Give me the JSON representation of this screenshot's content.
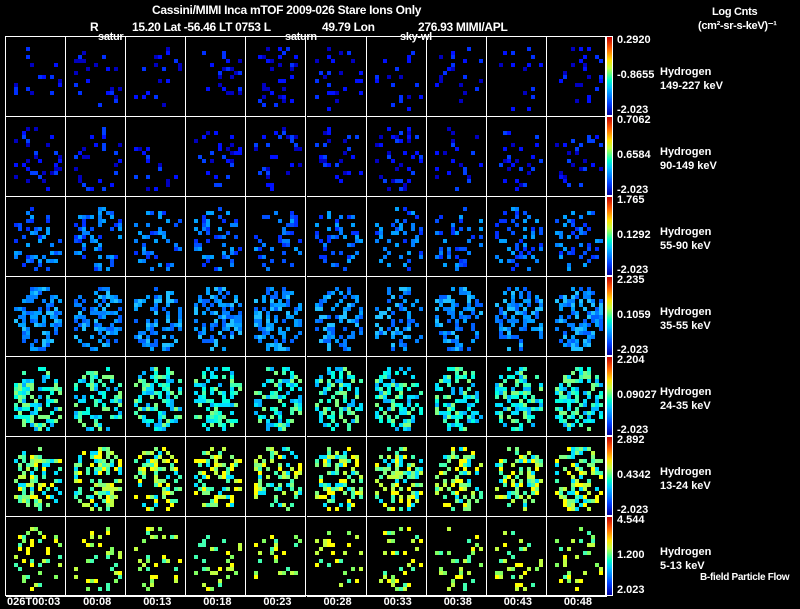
{
  "title": "Cassini/MIMI Inca mTOF  2009-026   Stare   Ions Only",
  "subtitle": {
    "r_label": "R",
    "r_value": "15.20 Lat -56.46 LT 0753 L",
    "l_value": "49.79 Lon",
    "lon_value": "276.93  MIMI/APL"
  },
  "panel_labels": [
    "satur",
    "saturn",
    "sky-wl"
  ],
  "units": {
    "line1": "Log Cnts",
    "line2": "(cm²-sr-s-keV)⁻¹"
  },
  "footer_note": "B-field Particle Flow",
  "chart_data": {
    "type": "heatmap",
    "title": "Cassini/MIMI Inca mTOF  2009-026   Stare   Ions Only",
    "colorbar_label": "Log Cnts (cm²-sr-s-keV)⁻¹",
    "time_labels": [
      "026T00:03",
      "00:08",
      "00:13",
      "00:18",
      "00:23",
      "00:28",
      "00:33",
      "00:38",
      "00:43",
      "00:48"
    ],
    "rows": [
      {
        "species": "Hydrogen",
        "energy": "149-227 keV",
        "max": "0.2920",
        "mid": "-0.8655",
        "min": "-2.023"
      },
      {
        "species": "Hydrogen",
        "energy": "90-149 keV",
        "max": "0.7062",
        "mid": "0.6584",
        "min": "-2.023"
      },
      {
        "species": "Hydrogen",
        "energy": "55-90 keV",
        "max": "1.765",
        "mid": "0.1292",
        "min": "-2.023"
      },
      {
        "species": "Hydrogen",
        "energy": "35-55 keV",
        "max": "2.235",
        "mid": "0.1059",
        "min": "-2.023"
      },
      {
        "species": "Hydrogen",
        "energy": "24-35 keV",
        "max": "2.204",
        "mid": "0.09027",
        "min": "-2.023"
      },
      {
        "species": "Hydrogen",
        "energy": "13-24 keV",
        "max": "2.892",
        "mid": "0.4342",
        "min": "-2.023"
      },
      {
        "species": "Hydrogen",
        "energy": "5-13 keV",
        "max": "4.544",
        "mid": "1.200",
        "min": "2.023"
      }
    ]
  }
}
